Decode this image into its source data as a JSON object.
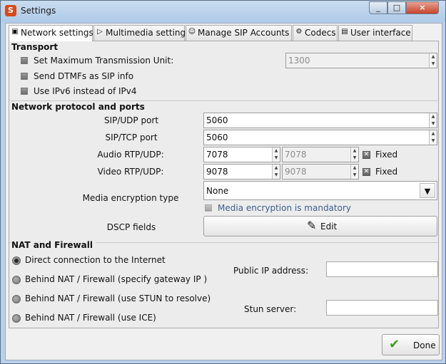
{
  "window": {
    "title": "Settings",
    "buttons": {
      "min": "_",
      "max": "□",
      "close": "×"
    }
  },
  "tabs": [
    {
      "label": "Network settings",
      "icon": "network-icon",
      "glyph": "▣",
      "active": true
    },
    {
      "label": "Multimedia settings",
      "icon": "play-icon",
      "glyph": "▷",
      "active": false
    },
    {
      "label": "Manage SIP Accounts",
      "icon": "users-icon",
      "glyph": "☺",
      "active": false
    },
    {
      "label": "Codecs",
      "icon": "codecs-icon",
      "glyph": "⚙",
      "active": false
    },
    {
      "label": "User interface",
      "icon": "ui-icon",
      "glyph": "▤",
      "active": false
    }
  ],
  "transport": {
    "title": "Transport",
    "mtu_label": "Set Maximum Transmission Unit:",
    "mtu_value": "1300",
    "dtmf_label": "Send DTMFs as SIP info",
    "ipv6_label": "Use IPv6 instead of IPv4"
  },
  "network": {
    "title": "Network protocol and ports",
    "sip_udp_label": "SIP/UDP port",
    "sip_udp_value": "5060",
    "sip_tcp_label": "SIP/TCP port",
    "sip_tcp_value": "5060",
    "audio_rtp_label": "Audio RTP/UDP:",
    "audio_rtp_value": "7078",
    "audio_rtp_value2": "7078",
    "audio_fixed_label": "Fixed",
    "video_rtp_label": "Video RTP/UDP:",
    "video_rtp_value": "9078",
    "video_rtp_value2": "9078",
    "video_fixed_label": "Fixed",
    "media_enc_label": "Media encryption type",
    "media_enc_value": "None",
    "media_enc_mandatory_label": "Media encryption is mandatory",
    "dscp_label": "DSCP fields",
    "edit_label": "Edit"
  },
  "nat": {
    "title": "NAT and Firewall",
    "options": [
      {
        "label": "Direct connection to the Internet",
        "selected": true
      },
      {
        "label": "Behind NAT / Firewall (specify gateway IP )",
        "selected": false
      },
      {
        "label": "Behind NAT / Firewall (use STUN to resolve)",
        "selected": false
      },
      {
        "label": "Behind NAT / Firewall (use ICE)",
        "selected": false
      }
    ],
    "public_ip_label": "Public IP address:",
    "public_ip_value": "",
    "stun_label": "Stun server:",
    "stun_value": ""
  },
  "footer": {
    "done_label": "Done"
  }
}
